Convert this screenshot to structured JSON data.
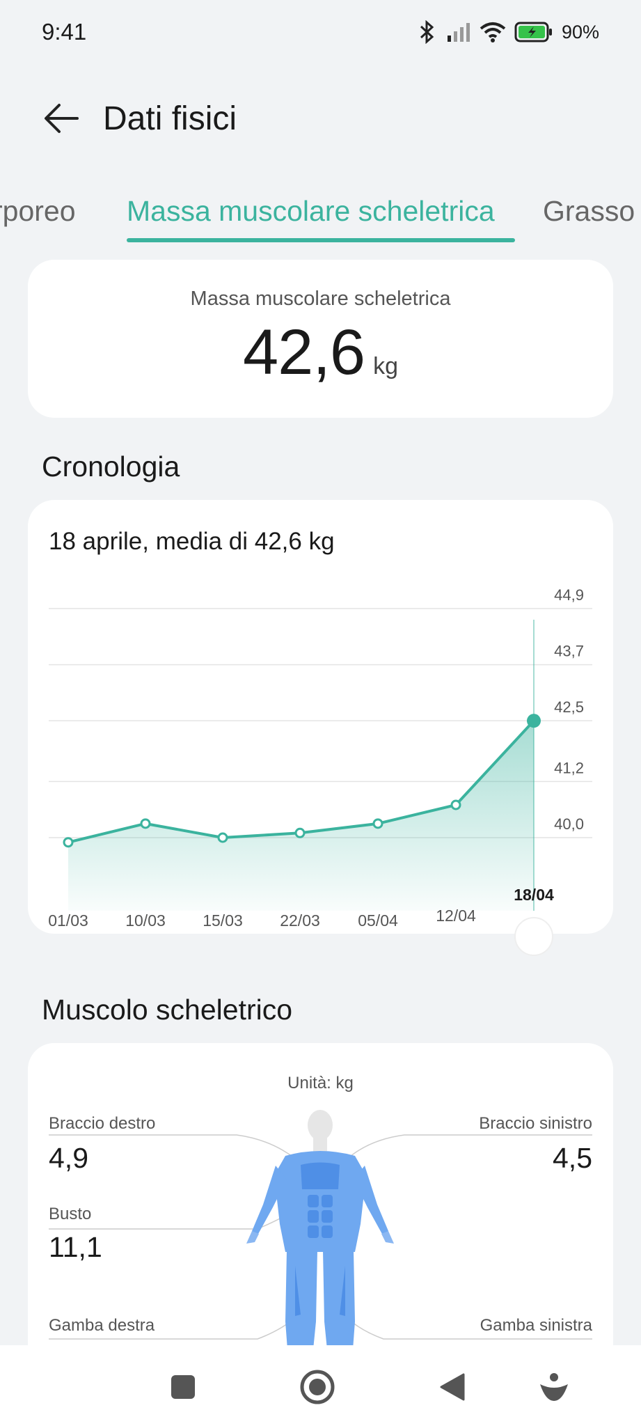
{
  "status": {
    "time": "9:41",
    "battery": "90%"
  },
  "header": {
    "title": "Dati fisici"
  },
  "tabs": [
    {
      "label": "rporeo"
    },
    {
      "label": "Massa muscolare scheletrica"
    },
    {
      "label": "Grasso"
    }
  ],
  "summary": {
    "label": "Massa muscolare scheletrica",
    "value": "42,6",
    "unit": "kg"
  },
  "history": {
    "section_title": "Cronologia",
    "subtitle": "18 aprile, media di 42,6 kg"
  },
  "chart_data": {
    "type": "area",
    "x": [
      "01/03",
      "10/03",
      "15/03",
      "22/03",
      "05/04",
      "12/04",
      "18/04"
    ],
    "values": [
      39.9,
      40.3,
      40.0,
      40.1,
      40.3,
      40.7,
      42.5
    ],
    "yticks": [
      "44,9",
      "43,7",
      "42,5",
      "41,2",
      "40,0"
    ],
    "ytick_values": [
      44.9,
      43.7,
      42.5,
      41.2,
      40.0
    ],
    "ylim": [
      40.0,
      44.9
    ],
    "selected_x": "18/04",
    "grid": true,
    "color": "#3bb39e"
  },
  "muscle": {
    "section_title": "Muscolo scheletrico",
    "unit_label": "Unità: kg",
    "right_arm_label": "Braccio destro",
    "right_arm_value": "4,9",
    "left_arm_label": "Braccio sinistro",
    "left_arm_value": "4,5",
    "torso_label": "Busto",
    "torso_value": "11,1",
    "right_leg_label": "Gamba destra",
    "left_leg_label": "Gamba sinistra"
  },
  "nav": {
    "icons": [
      "square-icon",
      "home-circle-icon",
      "back-triangle-icon",
      "assistant-icon"
    ]
  },
  "colors": {
    "accent": "#3bb39e",
    "background": "#f1f3f5",
    "body_model": "#6fa8f0"
  }
}
